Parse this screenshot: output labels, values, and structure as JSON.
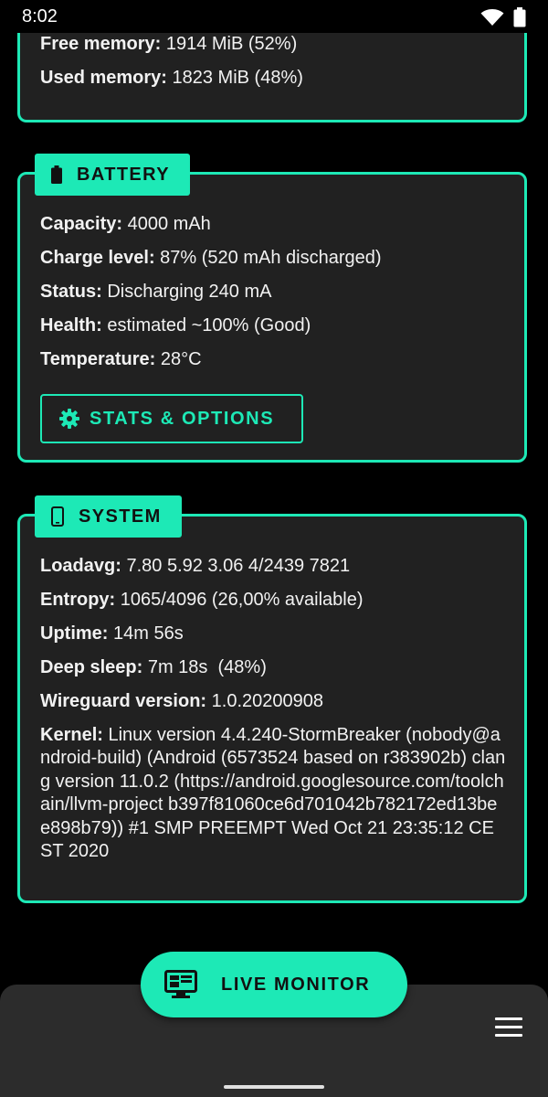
{
  "status_bar": {
    "time": "8:02",
    "icons": [
      "wifi-icon",
      "battery-icon"
    ]
  },
  "memory": {
    "rows": [
      {
        "label": "Free memory:",
        "value": " 1914 MiB (52%)"
      },
      {
        "label": "Used memory:",
        "value": " 1823 MiB (48%)"
      }
    ]
  },
  "battery": {
    "title": "BATTERY",
    "icon": "battery-icon",
    "rows": [
      {
        "label": "Capacity:",
        "value": " 4000 mAh"
      },
      {
        "label": "Charge level:",
        "value": " 87% (520 mAh discharged)"
      },
      {
        "label": "Status:",
        "value": " Discharging 240 mA"
      },
      {
        "label": "Health:",
        "value": " estimated ~100% (Good)"
      },
      {
        "label": "Temperature:",
        "value": " 28°C"
      }
    ],
    "button_label": "STATS & OPTIONS"
  },
  "system": {
    "title": "SYSTEM",
    "icon": "phone-icon",
    "rows": [
      {
        "label": "Loadavg:",
        "value": " 7.80 5.92 3.06 4/2439 7821"
      },
      {
        "label": "Entropy:",
        "value": " 1065/4096 (26,00% available)"
      },
      {
        "label": "Uptime:",
        "value": " 14m 56s"
      },
      {
        "label": "Deep sleep:",
        "value": " 7m 18s  (48%)"
      },
      {
        "label": "Wireguard version:",
        "value": " 1.0.20200908"
      }
    ],
    "kernel_label": "Kernel:",
    "kernel_value": " Linux version 4.4.240-StormBreaker (nobody@android-build) (Android (6573524 based on r383902b) clang version 11.0.2 (https://android.googlesource.com/toolchain/llvm-project b397f81060ce6d701042b782172ed13bee898b79)) #1 SMP PREEMPT Wed Oct 21 23:35:12 CEST 2020"
  },
  "fab": {
    "label": "LIVE MONITOR",
    "icon": "monitor-icon"
  },
  "bottom_bar": {
    "menu_icon": "hamburger-menu-icon"
  },
  "colors": {
    "accent": "#1de9b6",
    "card_bg": "#212121",
    "background": "#000000"
  }
}
